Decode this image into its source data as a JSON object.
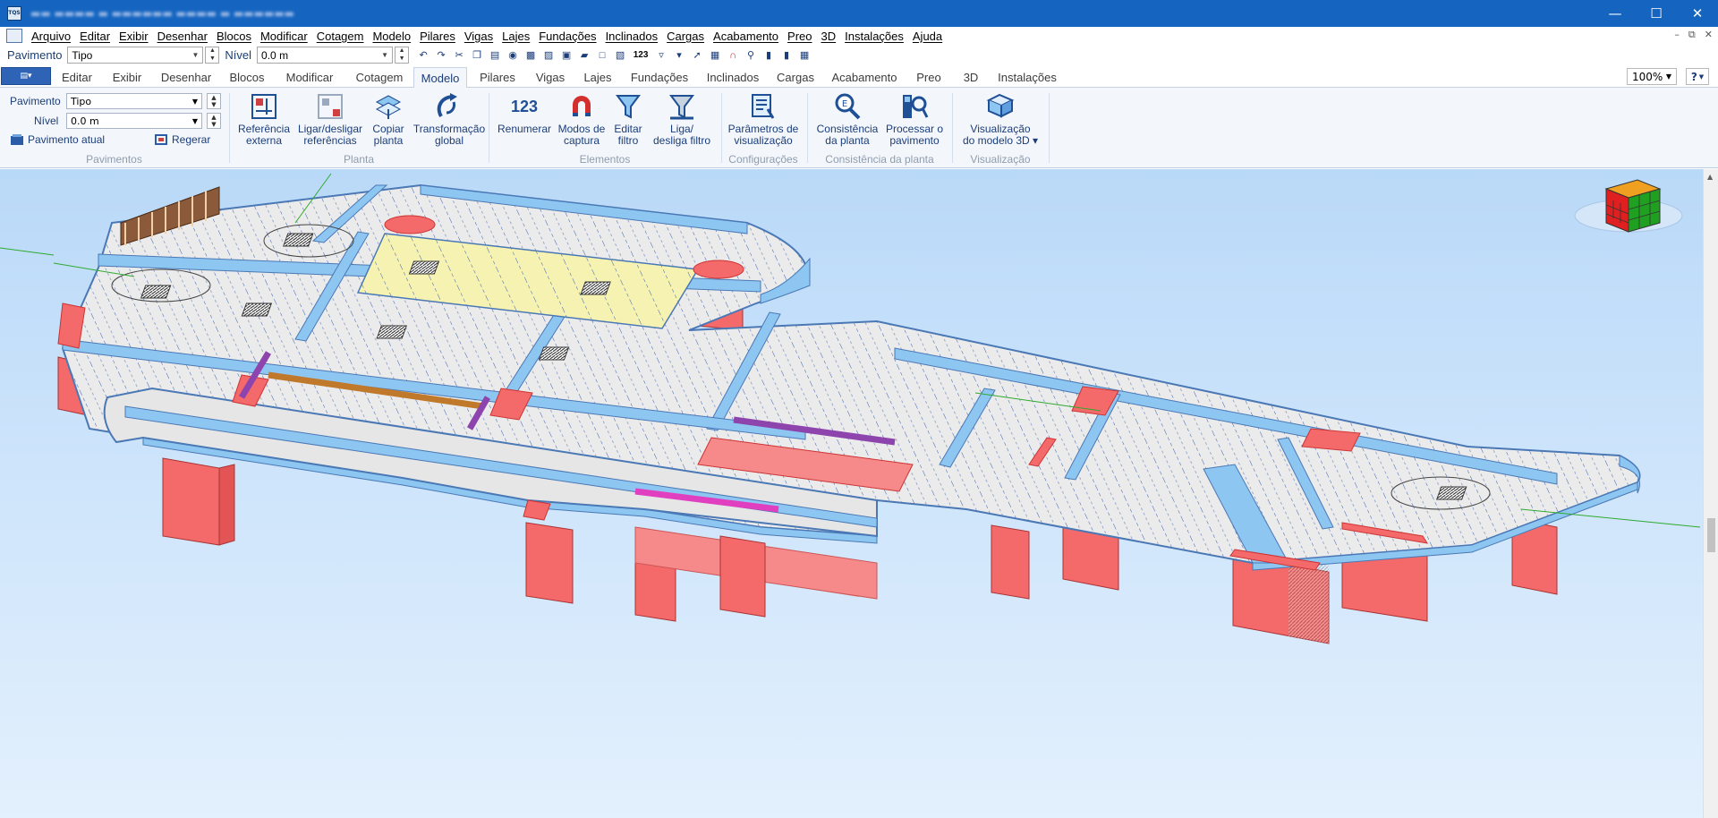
{
  "menu": [
    "Arquivo",
    "Editar",
    "Exibir",
    "Desenhar",
    "Blocos",
    "Modificar",
    "Cotagem",
    "Modelo",
    "Pilares",
    "Vigas",
    "Lajes",
    "Fundações",
    "Inclinados",
    "Cargas",
    "Acabamento",
    "Preo",
    "3D",
    "Instalações",
    "Ajuda"
  ],
  "quickbar": {
    "pavimento_label": "Pavimento",
    "pavimento_value": "Tipo",
    "nivel_label": "Nível",
    "nivel_value": "0.0 m",
    "number_icon": "123"
  },
  "tabs": [
    "Editar",
    "Exibir",
    "Desenhar",
    "Blocos",
    "Modificar",
    "Cotagem",
    "Modelo",
    "Pilares",
    "Vigas",
    "Lajes",
    "Fundações",
    "Inclinados",
    "Cargas",
    "Acabamento",
    "Preo",
    "3D",
    "Instalações"
  ],
  "active_tab": "Modelo",
  "zoom": "100%",
  "help": "?",
  "ribbon": {
    "pavimentos": {
      "label": "Pavimentos",
      "pavimento_label": "Pavimento",
      "pavimento_value": "Tipo",
      "nivel_label": "Nível",
      "nivel_value": "0.0 m",
      "pavimento_atual": "Pavimento atual",
      "regerar": "Regerar"
    },
    "planta": {
      "label": "Planta",
      "buttons": [
        {
          "l1": "Referência",
          "l2": "externa"
        },
        {
          "l1": "Ligar/desligar",
          "l2": "referências"
        },
        {
          "l1": "Copiar",
          "l2": "planta"
        },
        {
          "l1": "Transformação",
          "l2": "global"
        }
      ]
    },
    "elementos": {
      "label": "Elementos",
      "icon_text": "123",
      "buttons": [
        {
          "l1": "Renumerar",
          "l2": ""
        },
        {
          "l1": "Modos de",
          "l2": "captura"
        },
        {
          "l1": "Editar",
          "l2": "filtro"
        },
        {
          "l1": "Liga/",
          "l2": "desliga filtro"
        }
      ]
    },
    "configuracoes": {
      "label": "Configurações",
      "buttons": [
        {
          "l1": "Parâmetros de",
          "l2": "visualização"
        }
      ]
    },
    "consistencia": {
      "label": "Consistência da planta",
      "buttons": [
        {
          "l1": "Consistência",
          "l2": "da planta"
        },
        {
          "l1": "Processar o",
          "l2": "pavimento"
        }
      ]
    },
    "visualizacao": {
      "label": "Visualização",
      "buttons": [
        {
          "l1": "Visualização",
          "l2": "do modelo 3D ▾"
        }
      ]
    }
  },
  "colors": {
    "titlebar": "#1565c0",
    "slab": "#eeeeee",
    "beam": "#8ec6f2",
    "pillar": "#f46a6a",
    "highlight_slab": "#f6f3b2",
    "active_tab_text": "#1b3d7a"
  }
}
